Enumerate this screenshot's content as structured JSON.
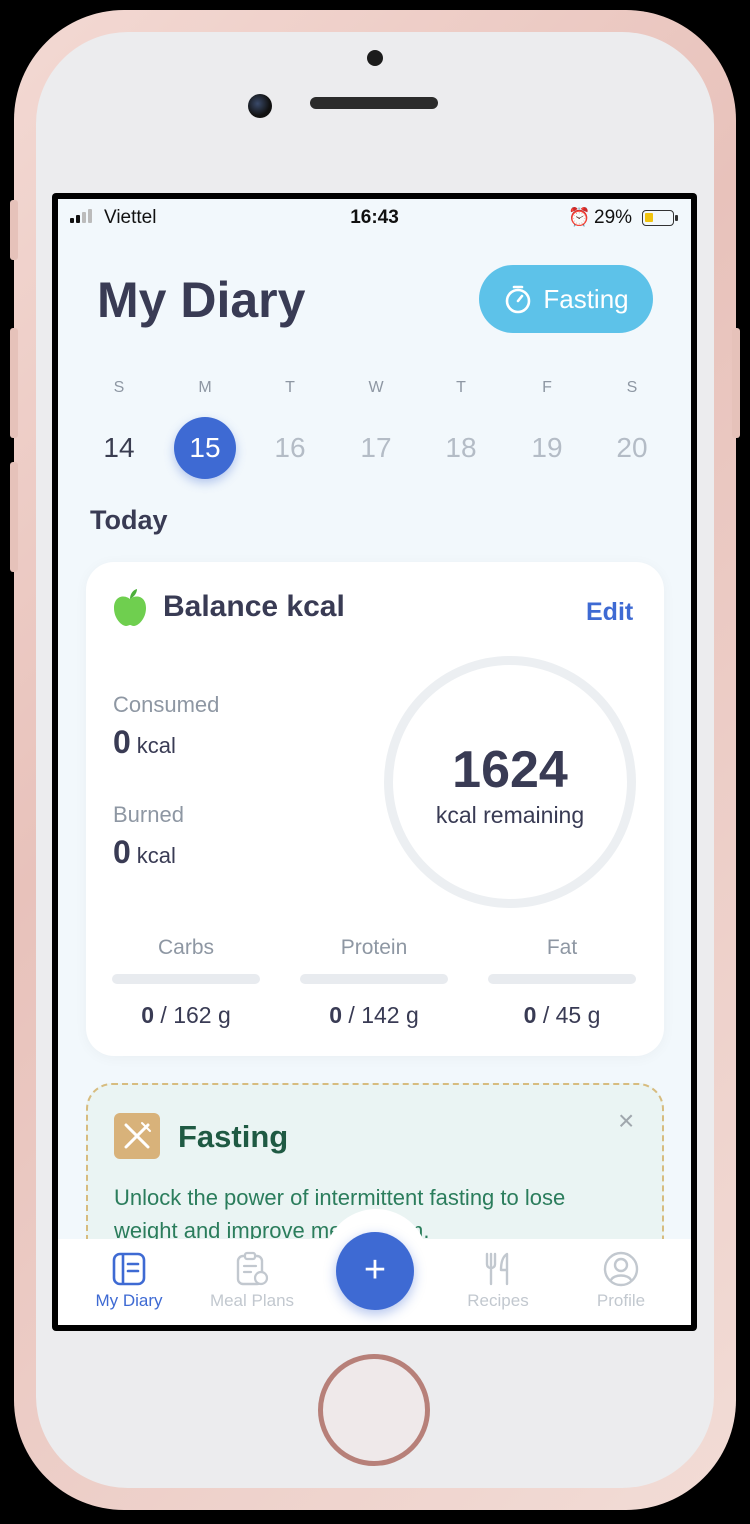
{
  "status_bar": {
    "carrier": "Viettel",
    "time": "16:43",
    "battery": "29%",
    "battery_level": 0.29
  },
  "header": {
    "title": "My Diary",
    "fasting_button": "Fasting"
  },
  "week": {
    "days": [
      {
        "letter": "S",
        "date": "14",
        "state": "past"
      },
      {
        "letter": "M",
        "date": "15",
        "state": "active"
      },
      {
        "letter": "T",
        "date": "16",
        "state": "future"
      },
      {
        "letter": "W",
        "date": "17",
        "state": "future"
      },
      {
        "letter": "T",
        "date": "18",
        "state": "future"
      },
      {
        "letter": "F",
        "date": "19",
        "state": "future"
      },
      {
        "letter": "S",
        "date": "20",
        "state": "future"
      }
    ]
  },
  "section_title": "Today",
  "balance_card": {
    "icon": "apple-icon",
    "title": "Balance kcal",
    "edit": "Edit",
    "consumed_label": "Consumed",
    "consumed_value": "0",
    "consumed_unit": "kcal",
    "burned_label": "Burned",
    "burned_value": "0",
    "burned_unit": "kcal",
    "remaining_value": "1624",
    "remaining_label": "kcal remaining",
    "macros": [
      {
        "label": "Carbs",
        "current": "0",
        "target": "/ 162 g"
      },
      {
        "label": "Protein",
        "current": "0",
        "target": "/ 142 g"
      },
      {
        "label": "Fat",
        "current": "0",
        "target": "/ 45 g"
      }
    ]
  },
  "fasting_card": {
    "icon": "fork-knife-icon",
    "title": "Fasting",
    "close": "×",
    "text": "Unlock the power of intermittent fasting to lose weight and improve metabolism."
  },
  "bottom_nav": {
    "items": [
      {
        "label": "My Diary",
        "icon": "diary-icon"
      },
      {
        "label": "Meal Plans",
        "icon": "meal-plans-icon"
      },
      {
        "label": "Recipes",
        "icon": "fork-knife-icon"
      },
      {
        "label": "Profile",
        "icon": "profile-icon"
      }
    ],
    "add": "+"
  },
  "colors": {
    "accent": "#3e6ad3",
    "fasting_pill": "#5dc2e9",
    "title": "#393b54",
    "promo_green": "#2b7d5c"
  }
}
